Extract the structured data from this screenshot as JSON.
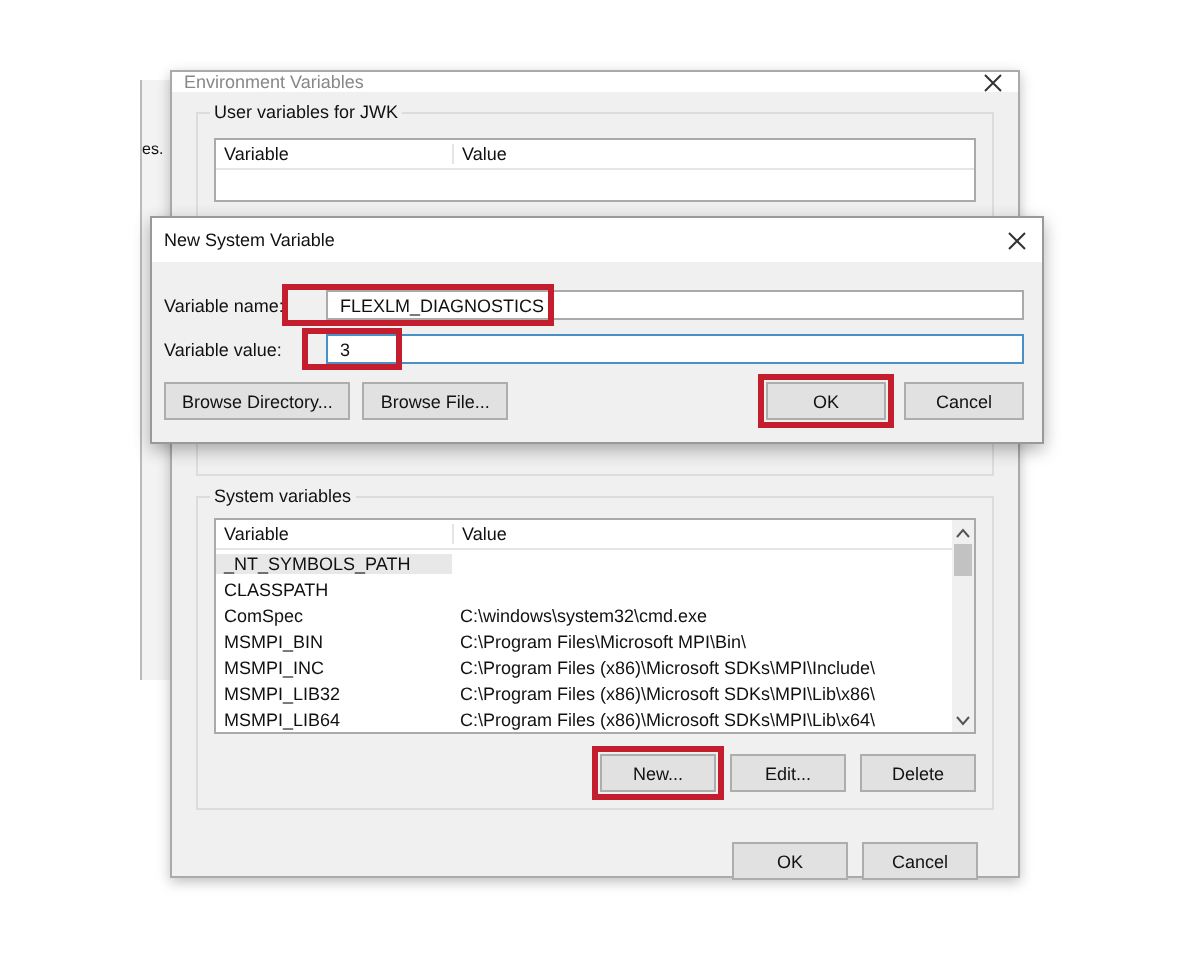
{
  "background_window": {
    "text": "es."
  },
  "environment_window": {
    "title": "Environment Variables",
    "user_group": {
      "label": "User variables for JWK",
      "columns": [
        "Variable",
        "Value"
      ]
    },
    "system_group": {
      "label": "System variables",
      "columns": [
        "Variable",
        "Value"
      ],
      "rows": [
        {
          "variable": "_NT_SYMBOLS_PATH",
          "selected": true
        },
        {
          "variable": "CLASSPATH",
          "selected": false
        },
        {
          "variable": "ComSpec",
          "value": "C:\\windows\\system32\\cmd.exe",
          "selected": false
        },
        {
          "variable": "MSMPI_BIN",
          "value": "C:\\Program Files\\Microsoft MPI\\Bin\\",
          "selected": false
        },
        {
          "variable": "MSMPI_INC",
          "value": "C:\\Program Files (x86)\\Microsoft SDKs\\MPI\\Include\\",
          "selected": false
        },
        {
          "variable": "MSMPI_LIB32",
          "value": "C:\\Program Files (x86)\\Microsoft SDKs\\MPI\\Lib\\x86\\",
          "selected": false
        },
        {
          "variable": "MSMPI_LIB64",
          "value": "C:\\Program Files (x86)\\Microsoft SDKs\\MPI\\Lib\\x64\\",
          "selected": false
        }
      ],
      "buttons": [
        {
          "label": "New...",
          "highlighted": true
        },
        {
          "label": "Edit...",
          "highlighted": false
        },
        {
          "label": "Delete",
          "highlighted": false
        }
      ]
    },
    "buttons": [
      {
        "label": "OK"
      },
      {
        "label": "Cancel"
      }
    ]
  },
  "new_variable_dialog": {
    "title": "New System Variable",
    "fields": [
      {
        "label": "Variable name:",
        "value": "FLEXLM_DIAGNOSTICS",
        "focused": false,
        "highlighted": true
      },
      {
        "label": "Variable value:",
        "value": "3",
        "focused": true,
        "highlighted": true
      }
    ],
    "browse_buttons": [
      {
        "label": "Browse Directory...",
        "highlighted": false
      },
      {
        "label": "Browse File...",
        "highlighted": false
      }
    ],
    "buttons": [
      {
        "label": "OK",
        "highlighted": true
      },
      {
        "label": "Cancel",
        "highlighted": false
      }
    ]
  }
}
